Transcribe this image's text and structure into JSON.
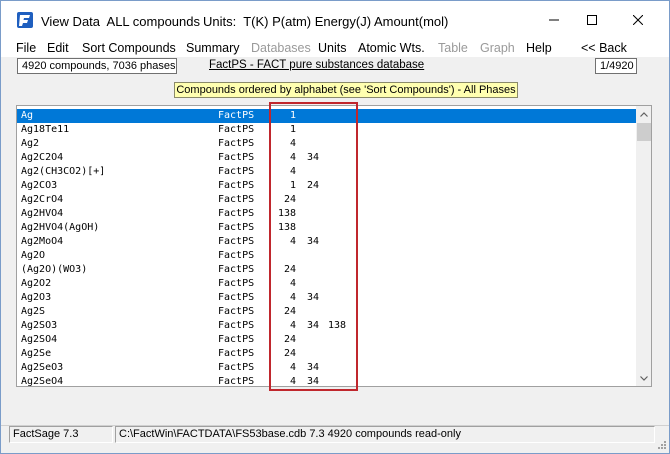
{
  "window": {
    "title": "View Data  ALL compounds",
    "units": "Units:  T(K) P(atm) Energy(J) Amount(mol)"
  },
  "menu": [
    {
      "label": "File",
      "enabled": true
    },
    {
      "label": "Edit",
      "enabled": true
    },
    {
      "label": "Sort Compounds",
      "enabled": true
    },
    {
      "label": "Summary",
      "enabled": true
    },
    {
      "label": "Databases",
      "enabled": false
    },
    {
      "label": "Units",
      "enabled": true
    },
    {
      "label": "Atomic Wts.",
      "enabled": true
    },
    {
      "label": "Table",
      "enabled": false
    },
    {
      "label": "Graph",
      "enabled": false
    },
    {
      "label": "Help",
      "enabled": true
    },
    {
      "label": "<<  Back",
      "enabled": true
    }
  ],
  "info": {
    "counts": "4920 compounds,  7036 phases",
    "database": "FactPS - FACT pure substances database",
    "position": "1/4920"
  },
  "banner": "Compounds ordered by alphabet (see 'Sort Compounds')  - All Phases",
  "compounds": [
    {
      "name": "Ag",
      "db": "FactPS",
      "p1": "1",
      "p2": "",
      "p3": "",
      "selected": true
    },
    {
      "name": "Ag18Te11",
      "db": "FactPS",
      "p1": "1",
      "p2": "",
      "p3": ""
    },
    {
      "name": "Ag2",
      "db": "FactPS",
      "p1": "4",
      "p2": "",
      "p3": ""
    },
    {
      "name": "Ag2C2O4",
      "db": "FactPS",
      "p1": "4",
      "p2": "34",
      "p3": ""
    },
    {
      "name": "Ag2(CH3CO2)[+]",
      "db": "FactPS",
      "p1": "4",
      "p2": "",
      "p3": ""
    },
    {
      "name": "Ag2CO3",
      "db": "FactPS",
      "p1": "1",
      "p2": "24",
      "p3": ""
    },
    {
      "name": "Ag2CrO4",
      "db": "FactPS",
      "p1": "24",
      "p2": "",
      "p3": ""
    },
    {
      "name": "Ag2HVO4",
      "db": "FactPS",
      "p1": "138",
      "p2": "",
      "p3": ""
    },
    {
      "name": "Ag2HVO4(AgOH)",
      "db": "FactPS",
      "p1": "138",
      "p2": "",
      "p3": ""
    },
    {
      "name": "Ag2MoO4",
      "db": "FactPS",
      "p1": "4",
      "p2": "34",
      "p3": ""
    },
    {
      "name": "Ag2O",
      "db": "FactPS",
      "p1": "",
      "p2": "",
      "p3": ""
    },
    {
      "name": "(Ag2O)(WO3)",
      "db": "FactPS",
      "p1": "24",
      "p2": "",
      "p3": ""
    },
    {
      "name": "Ag2O2",
      "db": "FactPS",
      "p1": "4",
      "p2": "",
      "p3": ""
    },
    {
      "name": "Ag2O3",
      "db": "FactPS",
      "p1": "4",
      "p2": "34",
      "p3": ""
    },
    {
      "name": "Ag2S",
      "db": "FactPS",
      "p1": "24",
      "p2": "",
      "p3": ""
    },
    {
      "name": "Ag2SO3",
      "db": "FactPS",
      "p1": "4",
      "p2": "34",
      "p3": "138"
    },
    {
      "name": "Ag2SO4",
      "db": "FactPS",
      "p1": "24",
      "p2": "",
      "p3": ""
    },
    {
      "name": "Ag2Se",
      "db": "FactPS",
      "p1": "24",
      "p2": "",
      "p3": ""
    },
    {
      "name": "Ag2SeO3",
      "db": "FactPS",
      "p1": "4",
      "p2": "34",
      "p3": ""
    },
    {
      "name": "Ag2SeO4",
      "db": "FactPS",
      "p1": "4",
      "p2": "34",
      "p3": ""
    }
  ],
  "status": {
    "version": "FactSage 7.3",
    "file": "C:\\FactWin\\FACTDATA\\FS53base.cdb 7.3   4920 compounds read-only"
  },
  "colors": {
    "selection": "#0078d7",
    "highlight": "#c0272d",
    "banner": "#ffffb0"
  }
}
